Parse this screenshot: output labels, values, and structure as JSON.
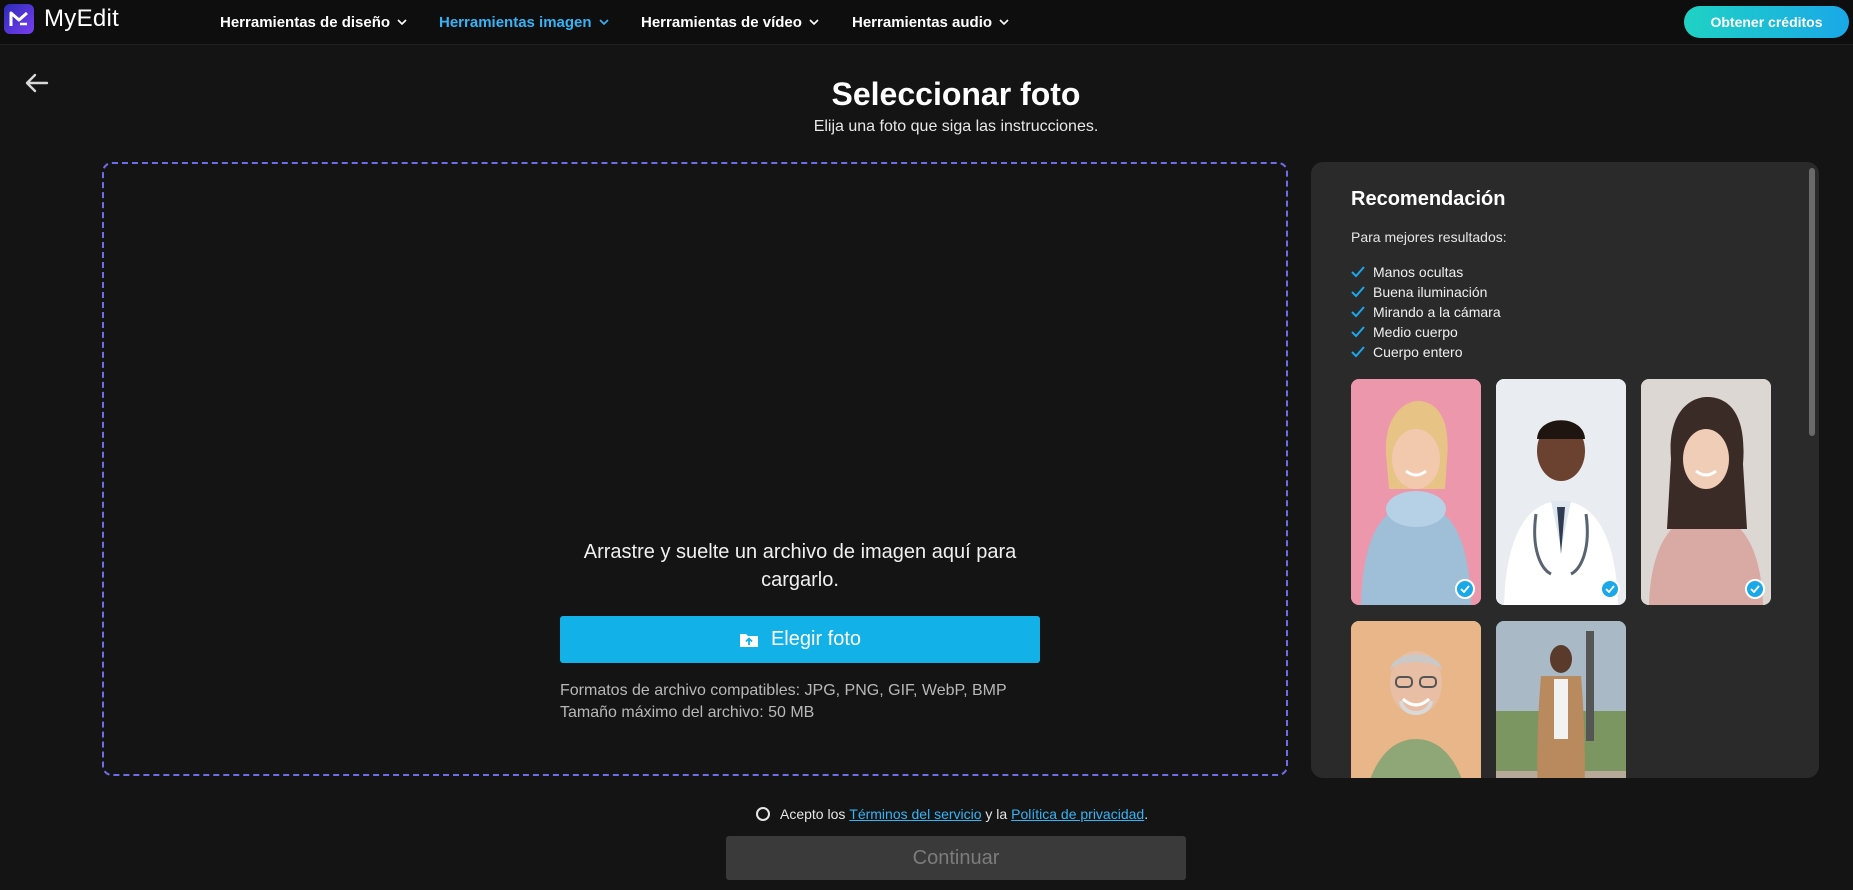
{
  "brand": {
    "name": "MyEdit"
  },
  "nav": {
    "items": [
      {
        "label": "Herramientas de diseño",
        "active": false
      },
      {
        "label": "Herramientas imagen",
        "active": true
      },
      {
        "label": "Herramientas de vídeo",
        "active": false
      },
      {
        "label": "Herramientas audio",
        "active": false
      }
    ],
    "credits_button": "Obtener créditos"
  },
  "page": {
    "title": "Seleccionar foto",
    "subtitle": "Elija una foto que siga las instrucciones."
  },
  "upload": {
    "instruction": "Arrastre y suelte un archivo de imagen aquí para cargarlo.",
    "choose_button": "Elegir foto",
    "formats": "Formatos de archivo compatibles: JPG, PNG, GIF, WebP, BMP",
    "max_size": "Tamaño máximo del archivo: 50 MB"
  },
  "recommendation": {
    "title": "Recomendación",
    "intro": "Para mejores resultados:",
    "tips": [
      "Manos ocultas",
      "Buena iluminación",
      "Mirando a la cámara",
      "Medio cuerpo",
      "Cuerpo entero"
    ],
    "photos": [
      {
        "name": "sample-photo-woman-blue-sweater",
        "checked": true
      },
      {
        "name": "sample-photo-doctor",
        "checked": true
      },
      {
        "name": "sample-photo-woman-pink-shirt",
        "checked": true
      },
      {
        "name": "sample-photo-older-man",
        "checked": false
      },
      {
        "name": "sample-photo-man-full-body",
        "checked": false
      }
    ]
  },
  "terms": {
    "prefix": "Acepto los",
    "terms_link": "Términos del servicio",
    "middle": "y la",
    "privacy_link": "Política de privacidad",
    "suffix": "."
  },
  "continue_button": "Continuar",
  "colors": {
    "background": "#141414",
    "accent": "#12b1e8",
    "active_nav": "#35b3f5",
    "panel": "#2a2a2a"
  }
}
